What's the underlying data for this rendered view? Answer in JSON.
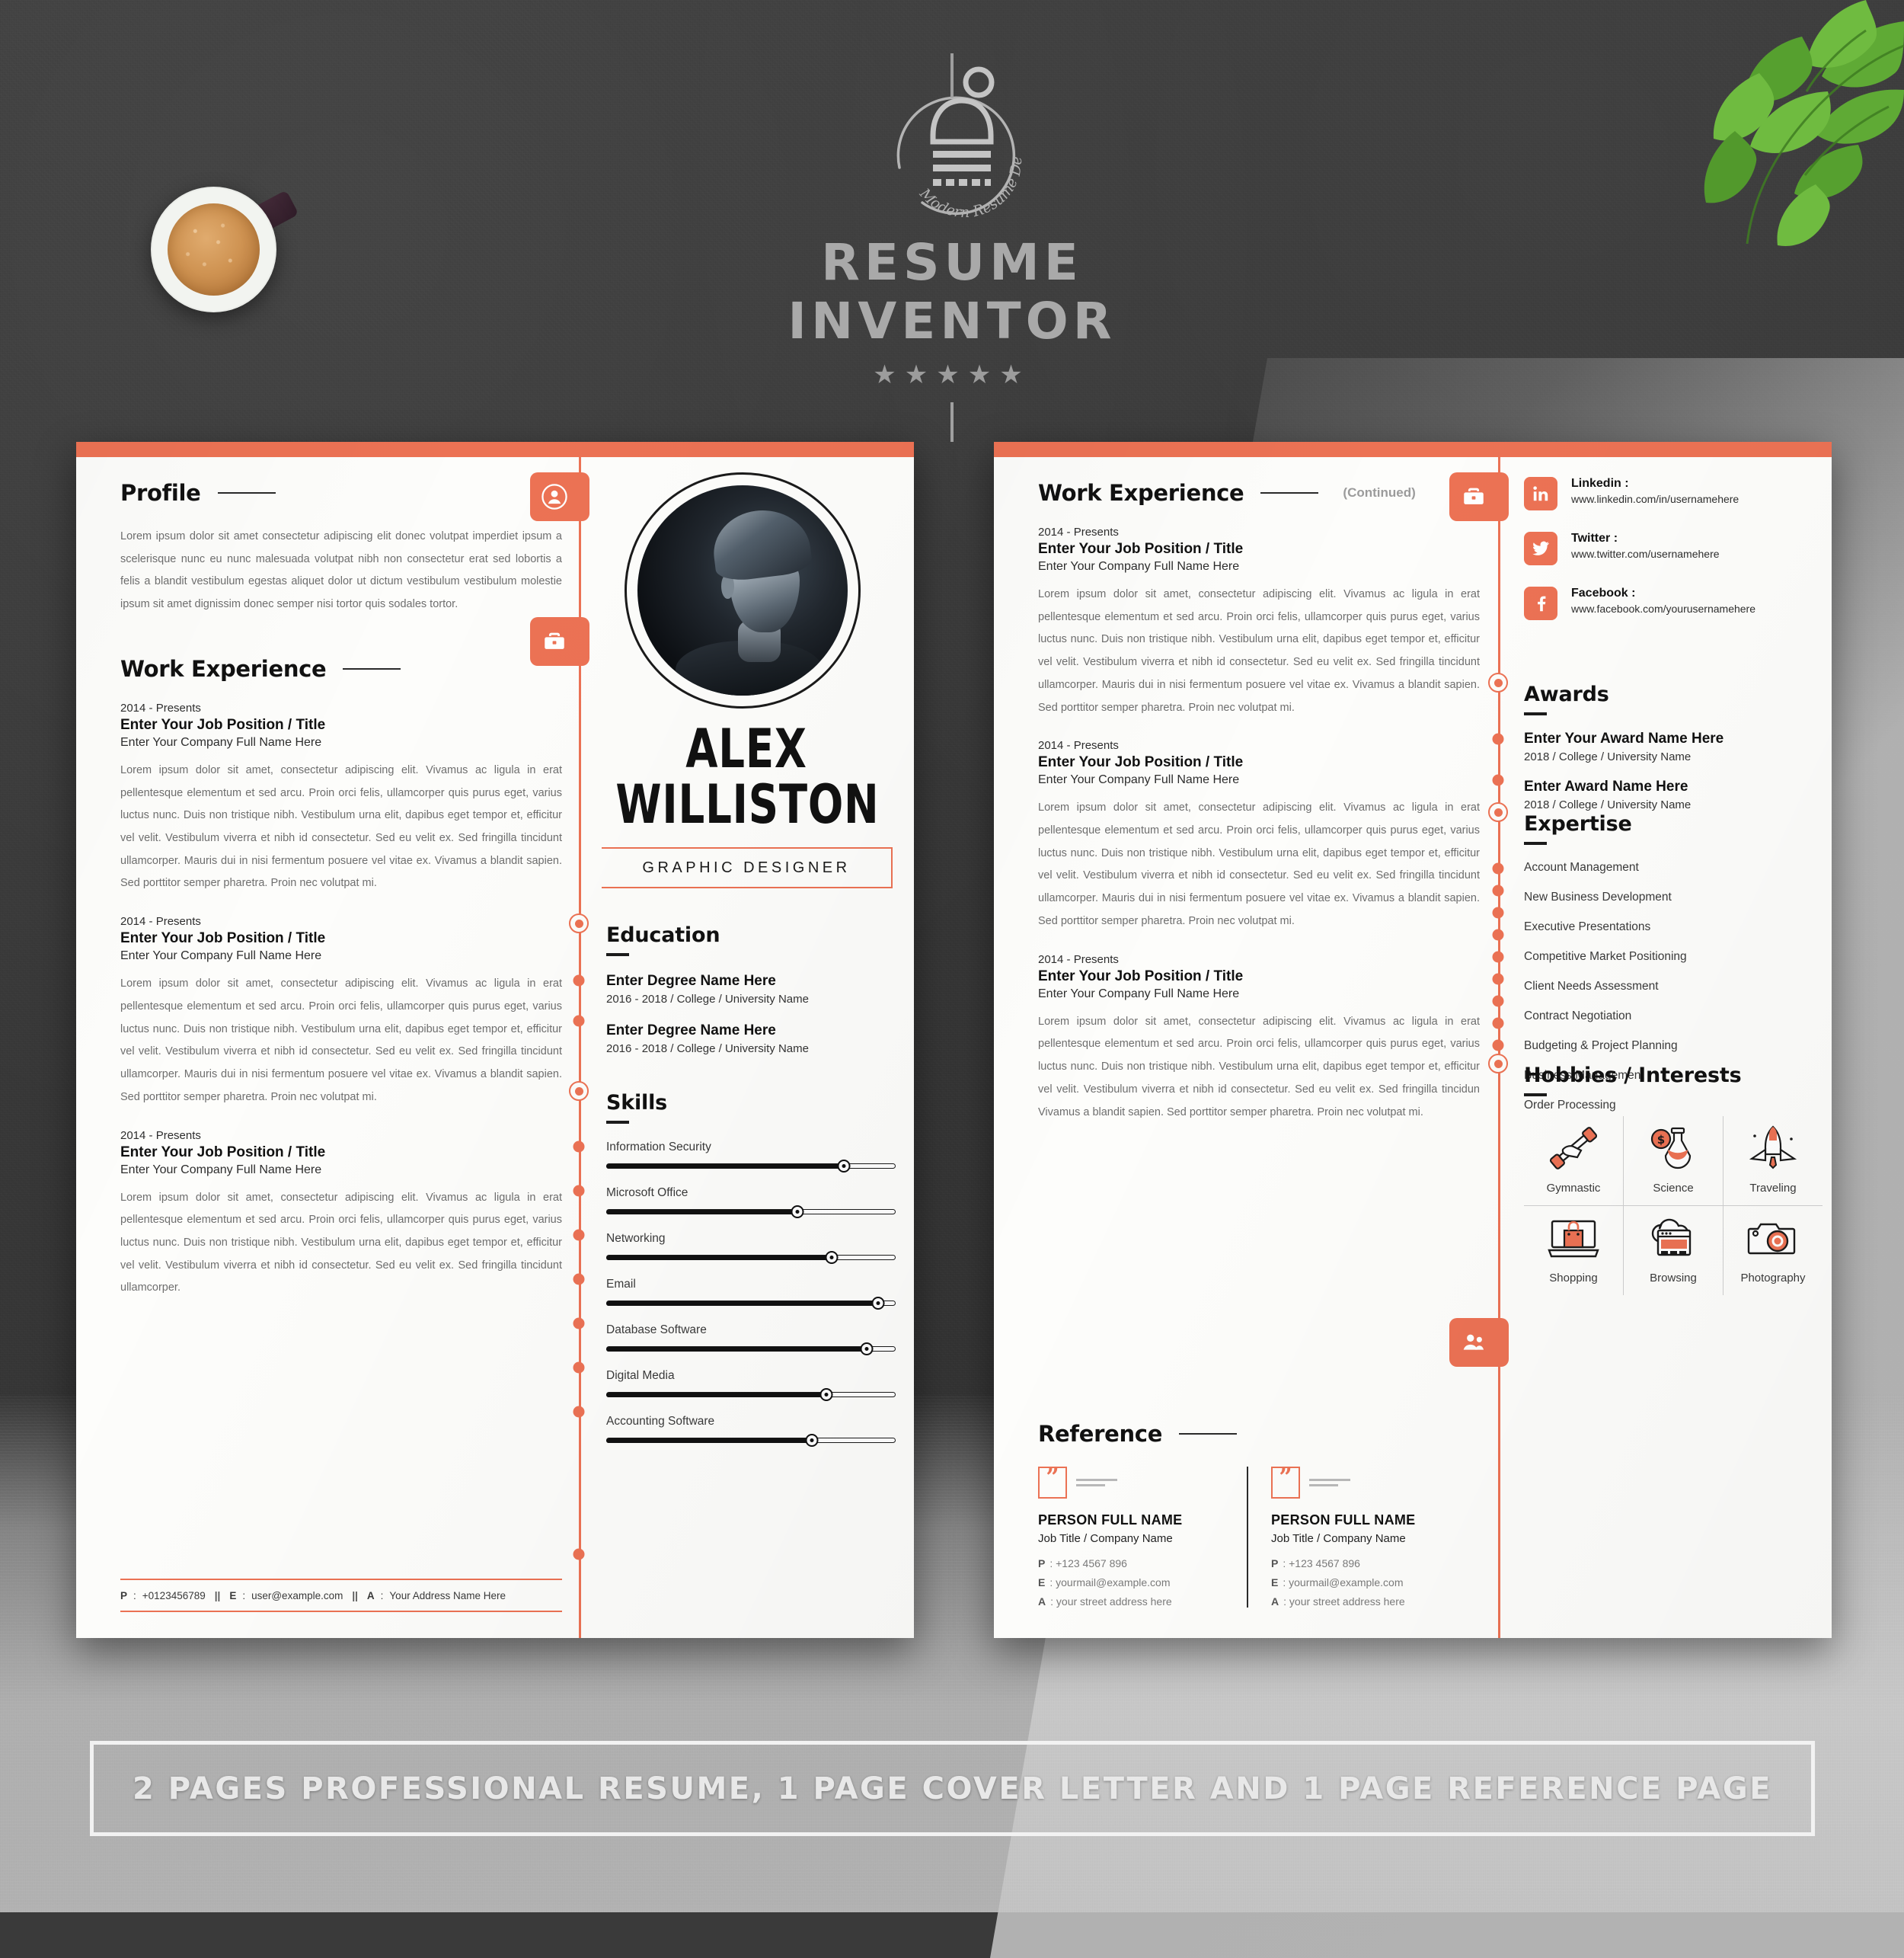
{
  "brand": {
    "title": "RESUME INVENTOR",
    "tagline": "Modern Resume Design",
    "stars": "★★★★★",
    "logo_letter": "D"
  },
  "banner": {
    "text": "2 PAGES PROFESSIONAL RESUME, 1 PAGE COVER LETTER AND 1 PAGE REFERENCE PAGE"
  },
  "colors": {
    "accent": "#ec7254",
    "ink": "#111111",
    "body": "#6e6e6e",
    "paper": "#fdfdfb"
  },
  "person": {
    "first_name": "ALEX",
    "last_name": "WILLISTON",
    "role": "GRAPHIC DESIGNER"
  },
  "left_page": {
    "profile": {
      "heading": "Profile",
      "text": "Lorem ipsum dolor sit amet consectetur adipiscing elit donec volutpat imperdiet ipsum a scelerisque nunc eu nunc malesuada volutpat nibh non consectetur erat sed lobortis a felis a blandit vestibulum egestas aliquet dolor ut dictum vestibulum vestibulum molestie ipsum sit amet dignissim donec semper nisi tortor quis sodales tortor."
    },
    "work": {
      "heading": "Work Experience",
      "jobs": [
        {
          "date": "2014 - Presents",
          "title": "Enter Your Job Position / Title",
          "company": "Enter Your Company Full Name Here",
          "text": "Lorem ipsum dolor sit amet, consectetur adipiscing elit. Vivamus ac ligula in erat pellentesque elementum et sed arcu. Proin orci felis, ullamcorper quis purus eget, varius luctus nunc. Duis non tristique nibh. Vestibulum urna elit, dapibus eget tempor et, efficitur vel velit. Vestibulum viverra et nibh id consectetur. Sed eu velit ex. Sed fringilla tincidunt ullamcorper. Mauris dui in nisi fermentum posuere vel vitae ex. Vivamus a blandit sapien. Sed porttitor semper pharetra. Proin nec volutpat mi."
        },
        {
          "date": "2014 - Presents",
          "title": "Enter Your Job Position / Title",
          "company": "Enter Your Company Full Name Here",
          "text": "Lorem ipsum dolor sit amet, consectetur adipiscing elit. Vivamus ac ligula in erat pellentesque elementum et sed arcu. Proin orci felis, ullamcorper quis purus eget, varius luctus nunc. Duis non tristique nibh. Vestibulum urna elit, dapibus eget tempor et, efficitur vel velit. Vestibulum viverra et nibh id consectetur. Sed eu velit ex. Sed fringilla tincidunt ullamcorper. Mauris dui in nisi fermentum posuere vel vitae ex. Vivamus a blandit sapien. Sed porttitor semper pharetra. Proin nec volutpat mi."
        },
        {
          "date": "2014 - Presents",
          "title": "Enter Your Job Position / Title",
          "company": "Enter Your Company Full Name Here",
          "text": "Lorem ipsum dolor sit amet, consectetur adipiscing elit. Vivamus ac ligula in erat pellentesque elementum et sed arcu. Proin orci felis, ullamcorper quis purus eget, varius luctus nunc. Duis non tristique nibh. Vestibulum urna elit, dapibus eget tempor et, efficitur vel velit. Vestibulum viverra et nibh id consectetur. Sed eu velit ex. Sed fringilla tincidunt ullamcorper."
        }
      ]
    },
    "contact": {
      "phone_key": "P",
      "phone": "+0123456789",
      "email_key": "E",
      "email": "user@example.com",
      "address_key": "A",
      "address": "Your Address Name Here",
      "separator": "||"
    },
    "education": {
      "heading": "Education",
      "items": [
        {
          "degree": "Enter Degree Name Here",
          "detail": "2016 - 2018 / College / University Name"
        },
        {
          "degree": "Enter Degree Name Here",
          "detail": "2016 - 2018 / College / University Name"
        }
      ]
    },
    "skills": {
      "heading": "Skills",
      "items": [
        {
          "name": "Information Security",
          "value": 82
        },
        {
          "name": "Microsoft Office",
          "value": 66
        },
        {
          "name": "Networking",
          "value": 78
        },
        {
          "name": "Email",
          "value": 94
        },
        {
          "name": "Database Software",
          "value": 90
        },
        {
          "name": "Digital Media",
          "value": 76
        },
        {
          "name": "Accounting Software",
          "value": 71
        }
      ]
    }
  },
  "right_page": {
    "work": {
      "heading": "Work Experience",
      "continued": "(Continued)",
      "jobs": [
        {
          "date": "2014 - Presents",
          "title": "Enter Your Job Position / Title",
          "company": "Enter Your Company Full Name Here",
          "text": "Lorem ipsum dolor sit amet, consectetur adipiscing elit. Vivamus ac ligula in erat pellentesque elementum et sed arcu. Proin orci felis, ullamcorper quis purus eget, varius luctus nunc. Duis non tristique nibh. Vestibulum urna elit, dapibus eget tempor et, efficitur vel velit. Vestibulum viverra et nibh id consectetur. Sed eu velit ex. Sed fringilla tincidunt ullamcorper. Mauris dui in nisi fermentum posuere vel vitae ex. Vivamus a blandit sapien. Sed porttitor semper pharetra. Proin nec volutpat mi."
        },
        {
          "date": "2014 - Presents",
          "title": "Enter Your Job Position / Title",
          "company": "Enter Your Company Full Name Here",
          "text": "Lorem ipsum dolor sit amet, consectetur adipiscing elit. Vivamus ac ligula in erat pellentesque elementum et sed arcu. Proin orci felis, ullamcorper quis purus eget, varius luctus nunc. Duis non tristique nibh. Vestibulum urna elit, dapibus eget tempor et, efficitur vel velit. Vestibulum viverra et nibh id consectetur. Sed eu velit ex. Sed fringilla tincidunt ullamcorper. Mauris dui in nisi fermentum posuere vel vitae ex. Vivamus a blandit sapien. Sed porttitor semper pharetra. Proin nec volutpat mi."
        },
        {
          "date": "2014 - Presents",
          "title": "Enter Your Job Position / Title",
          "company": "Enter Your Company Full Name Here",
          "text": "Lorem ipsum dolor sit amet, consectetur adipiscing elit. Vivamus ac ligula in erat pellentesque elementum et sed arcu. Proin orci felis, ullamcorper quis purus eget, varius luctus nunc. Duis non tristique nibh. Vestibulum urna elit, dapibus eget tempor et, efficitur vel velit. Vestibulum viverra et nibh id consectetur. Sed eu velit ex. Sed fringilla tincidun Vivamus a blandit sapien. Sed porttitor semper pharetra. Proin nec volutpat mi."
        }
      ]
    },
    "social": [
      {
        "icon": "linkedin-icon",
        "label": "Linkedin :",
        "url": "www.linkedin.com/in/usernamehere"
      },
      {
        "icon": "twitter-icon",
        "label": "Twitter :",
        "url": "www.twitter.com/usernamehere"
      },
      {
        "icon": "facebook-icon",
        "label": "Facebook :",
        "url": "www.facebook.com/yourusernamehere"
      }
    ],
    "awards": {
      "heading": "Awards",
      "items": [
        {
          "title": "Enter Your Award Name Here",
          "detail": "2018 / College / University Name"
        },
        {
          "title": "Enter Award Name Here",
          "detail": "2018 / College / University Name"
        }
      ]
    },
    "expertise": {
      "heading": "Expertise",
      "items": [
        "Account Management",
        "New Business Development",
        "Executive Presentations",
        "Competitive Market Positioning",
        "Client Needs Assessment",
        "Contract Negotiation",
        "Budgeting & Project Planning",
        "Business Management",
        "Order Processing"
      ]
    },
    "hobbies": {
      "heading": "Hobbies / Interests",
      "items": [
        {
          "label": "Gymnastic",
          "icon": "dumbbell-icon"
        },
        {
          "label": "Science",
          "icon": "flask-icon"
        },
        {
          "label": "Traveling",
          "icon": "rocket-icon"
        },
        {
          "label": "Shopping",
          "icon": "shopping-bag-laptop-icon"
        },
        {
          "label": "Browsing",
          "icon": "cloud-browser-icon"
        },
        {
          "label": "Photography",
          "icon": "camera-icon"
        }
      ]
    },
    "reference": {
      "heading": "Reference",
      "people": [
        {
          "name": "PERSON FULL NAME",
          "role": "Job Title / Company Name",
          "phone_key": "P",
          "phone": "+123 4567 896",
          "email_key": "E",
          "email": "yourmail@example.com",
          "address_key": "A",
          "address": "your street address here"
        },
        {
          "name": "PERSON FULL NAME",
          "role": "Job Title / Company Name",
          "phone_key": "P",
          "phone": "+123 4567 896",
          "email_key": "E",
          "email": "yourmail@example.com",
          "address_key": "A",
          "address": "your street address here"
        }
      ]
    }
  }
}
